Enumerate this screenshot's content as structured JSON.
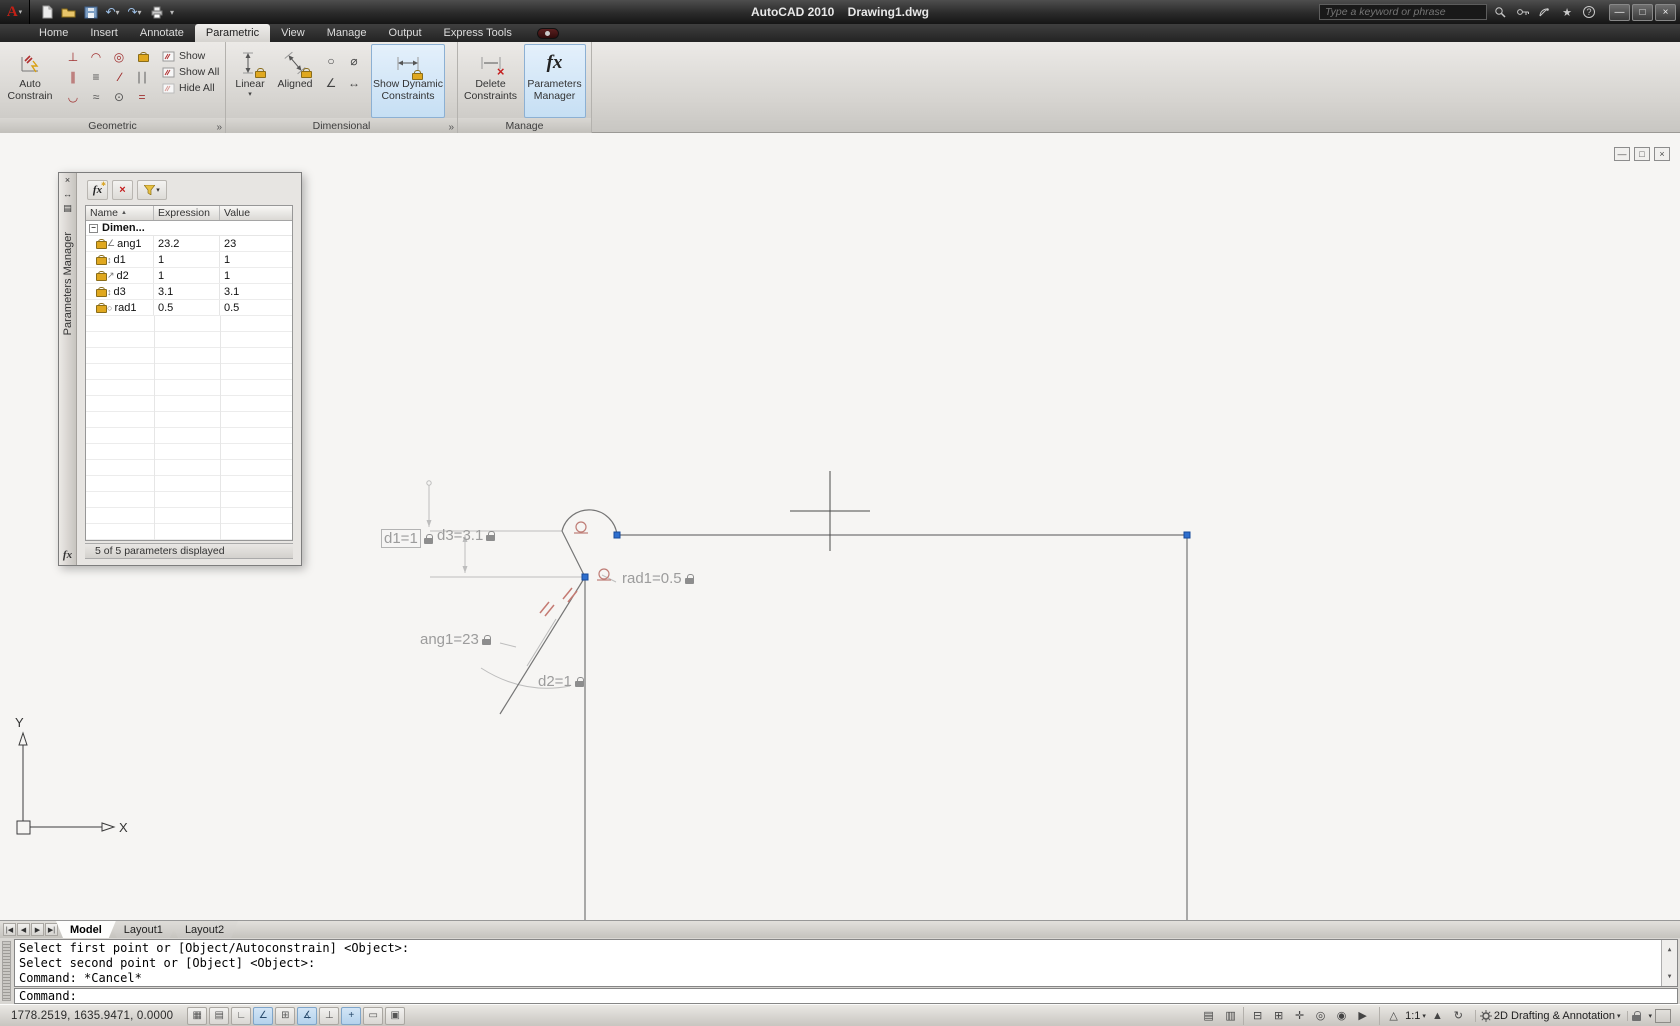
{
  "titlebar": {
    "app_title": "AutoCAD 2010",
    "doc_title": "Drawing1.dwg",
    "search_placeholder": "Type a keyword or phrase"
  },
  "ribbon": {
    "tabs": [
      {
        "label": "Home"
      },
      {
        "label": "Insert"
      },
      {
        "label": "Annotate"
      },
      {
        "label": "Parametric"
      },
      {
        "label": "View"
      },
      {
        "label": "Manage"
      },
      {
        "label": "Output"
      },
      {
        "label": "Express Tools"
      }
    ],
    "active_tab": "Parametric",
    "geometric": {
      "auto_constrain": "Auto Constrain",
      "show": "Show",
      "show_all": "Show All",
      "hide_all": "Hide All",
      "label": "Geometric",
      "icon_names": [
        "perpendicular",
        "tangent",
        "concentric",
        "fix",
        "parallel",
        "horizontal",
        "collinear",
        "vertical",
        "smooth",
        "symmetric",
        "coincident",
        "equal"
      ]
    },
    "dimensional": {
      "linear": "Linear",
      "aligned": "Aligned",
      "show_dynamic": "Show Dynamic Constraints",
      "label": "Dimensional",
      "icon_names": [
        "radius",
        "diameter",
        "angular",
        "convert"
      ]
    },
    "manage": {
      "delete_constraints": "Delete Constraints",
      "parameters_manager": "Parameters Manager",
      "label": "Manage"
    }
  },
  "palette": {
    "title": "Parameters Manager",
    "columns": [
      "Name",
      "Expression",
      "Value"
    ],
    "group": "Dimen...",
    "rows": [
      {
        "name": "ang1",
        "expression": "23.2",
        "value": "23"
      },
      {
        "name": "d1",
        "expression": "1",
        "value": "1"
      },
      {
        "name": "d2",
        "expression": "1",
        "value": "1"
      },
      {
        "name": "d3",
        "expression": "3.1",
        "value": "3.1"
      },
      {
        "name": "rad1",
        "expression": "0.5",
        "value": "0.5"
      }
    ],
    "status": "5 of 5 parameters displayed"
  },
  "canvas": {
    "constraints": {
      "d1": "d1=1",
      "d3": "d3=3.1",
      "rad1": "rad1=0.5",
      "ang1": "ang1=23",
      "d2": "d2=1"
    },
    "ucs": {
      "x": "X",
      "y": "Y"
    }
  },
  "layout_tabs": [
    {
      "label": "Model"
    },
    {
      "label": "Layout1"
    },
    {
      "label": "Layout2"
    }
  ],
  "command": {
    "lines": [
      "Select first point or [Object/Autoconstrain] <Object>:",
      "Select second point or [Object] <Object>:",
      "Command: *Cancel*"
    ],
    "prompt": "Command:"
  },
  "statusbar": {
    "coordinates": "1778.2519, 1635.9471, 0.0000",
    "toggle_names": [
      "snap",
      "grid",
      "ortho",
      "polar",
      "osnap",
      "otrack",
      "ducs",
      "dyn",
      "lwt",
      "qp"
    ],
    "annotation_scale": "1:1",
    "workspace": "2D Drafting & Annotation"
  },
  "colors": {
    "ribbon_highlight": "#c6dff4",
    "grip_blue": "#2e6fce",
    "constraint_text": "#9c9c9c",
    "lock_gold": "#e0a81f"
  }
}
